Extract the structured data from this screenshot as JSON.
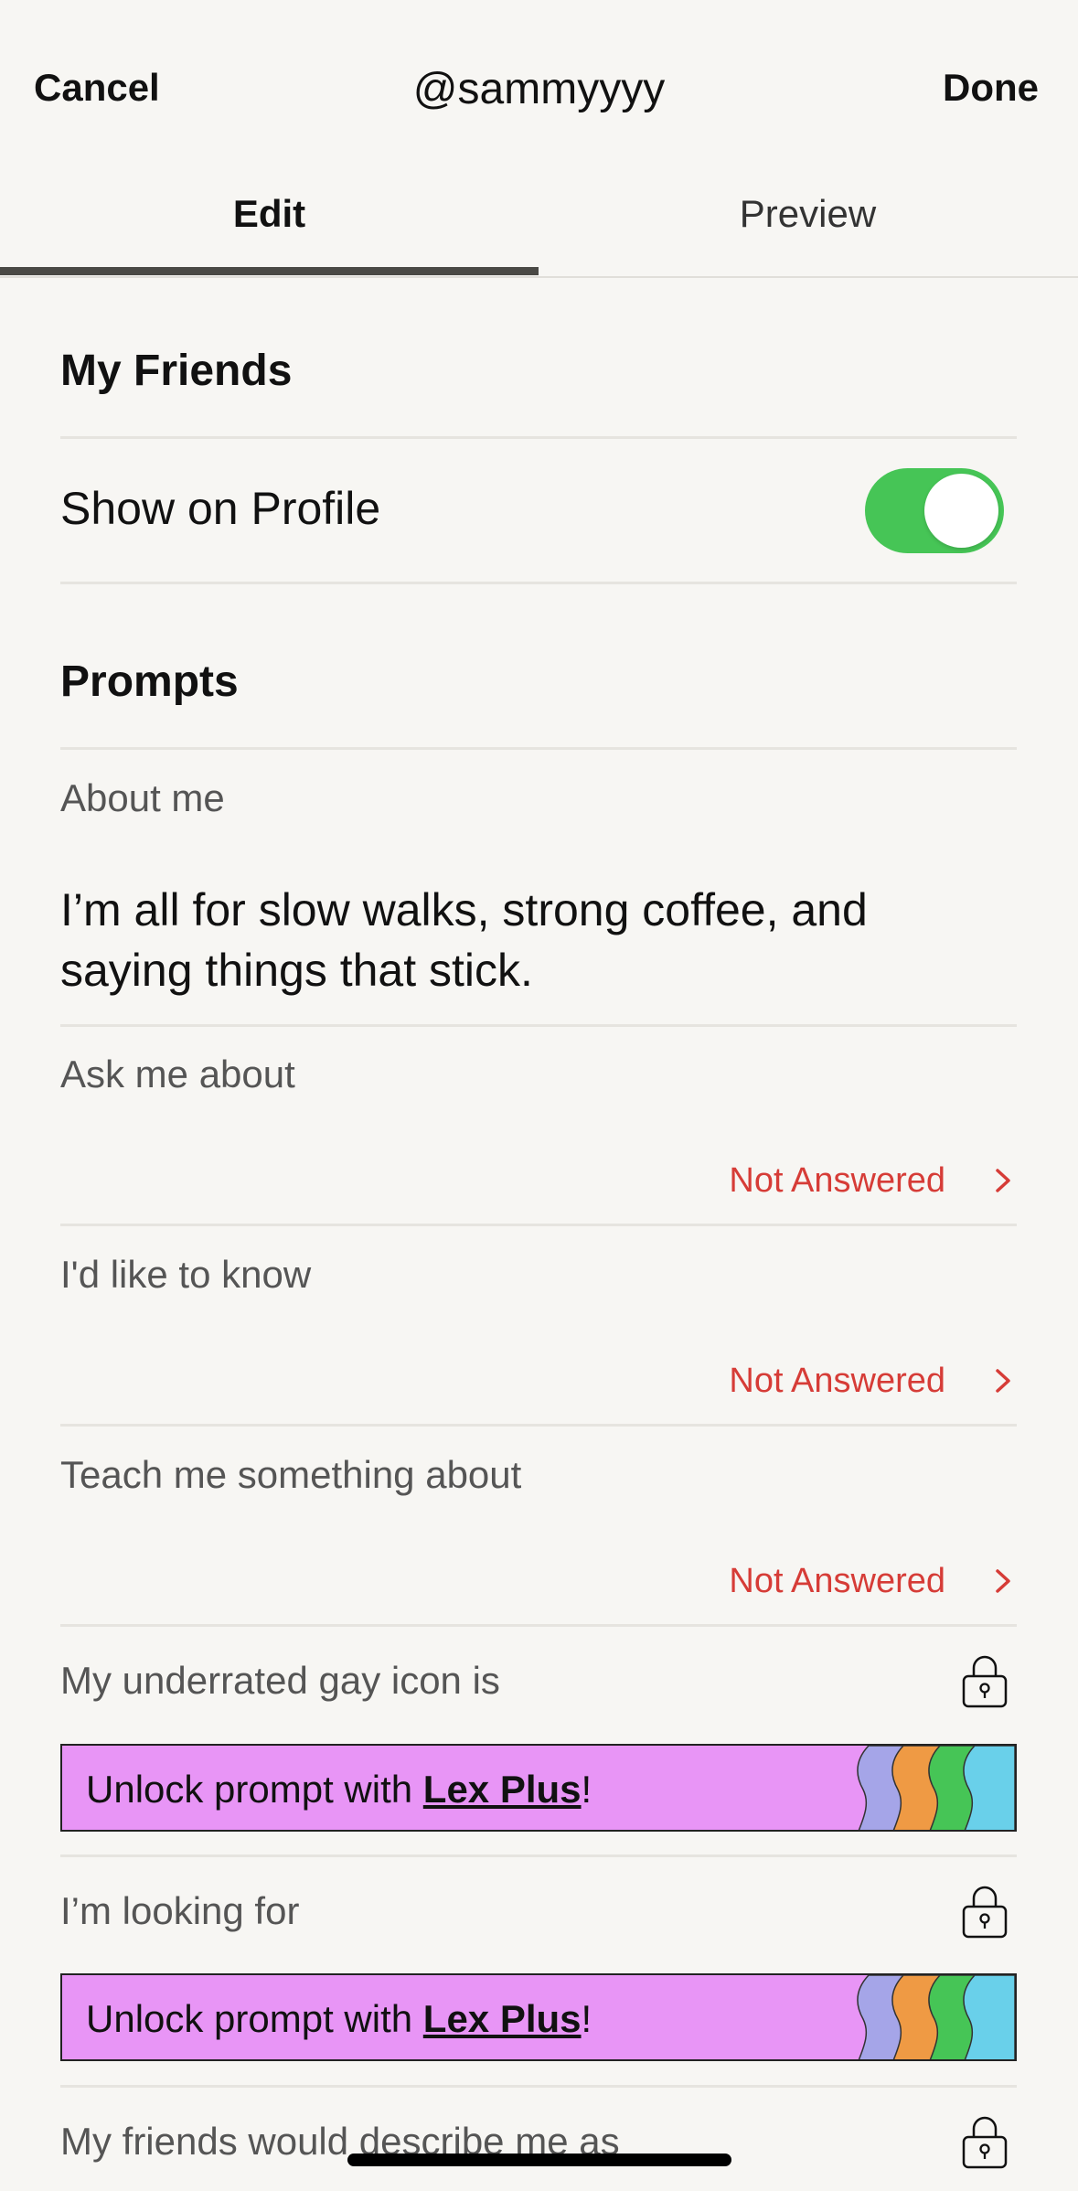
{
  "header": {
    "cancel_label": "Cancel",
    "username": "@sammyyyy",
    "done_label": "Done"
  },
  "tabs": [
    {
      "label": "Edit",
      "active": true
    },
    {
      "label": "Preview",
      "active": false
    }
  ],
  "my_friends": {
    "heading": "My Friends",
    "show_on_profile_label": "Show on Profile",
    "show_on_profile_enabled": true,
    "toggle_color": "#46c556"
  },
  "prompts": {
    "heading": "Prompts",
    "items": [
      {
        "label": "About me",
        "answer": "I’m all for slow walks, strong coffee, and saying things that stick."
      },
      {
        "label": "Ask me about",
        "status": "Not Answered"
      },
      {
        "label": "I'd like to know",
        "status": "Not Answered"
      },
      {
        "label": "Teach me something about",
        "status": "Not Answered"
      },
      {
        "label": "My underrated gay icon is",
        "locked": true,
        "unlock_prefix": "Unlock prompt with ",
        "unlock_link": "Lex Plus",
        "unlock_suffix": "!"
      },
      {
        "label": "I’m looking for",
        "locked": true,
        "unlock_prefix": "Unlock prompt with ",
        "unlock_link": "Lex Plus",
        "unlock_suffix": "!"
      },
      {
        "label": "My friends would describe me as",
        "locked": true
      }
    ]
  },
  "colors": {
    "not_answered": "#d63c37",
    "unlock_background": "#e895f6",
    "stripes": [
      "#a5a5e8",
      "#ef9a44",
      "#46c556",
      "#69d0ea"
    ]
  }
}
